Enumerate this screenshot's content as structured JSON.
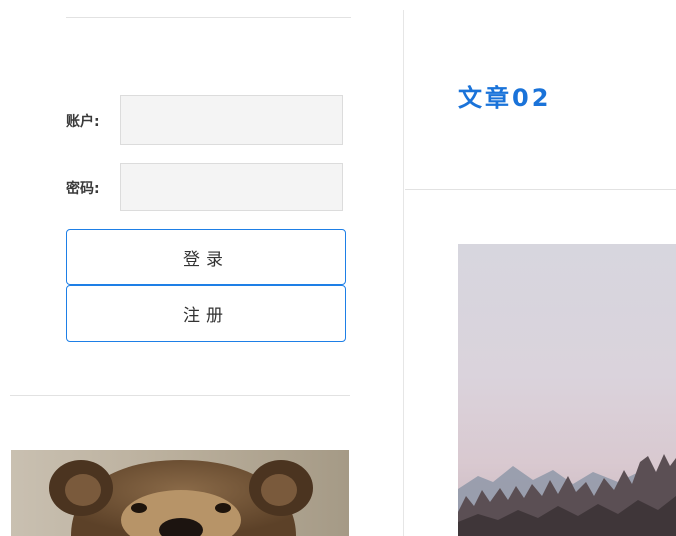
{
  "login": {
    "account_label": "账户:",
    "password_label": "密码:",
    "account_value": "",
    "password_value": "",
    "login_button": "登录",
    "register_button": "注册"
  },
  "article": {
    "title": "文章02"
  },
  "colors": {
    "accent": "#1e7fe6",
    "title": "#1a73d9",
    "input_bg": "#f4f4f4",
    "divider": "#e2e2e2"
  },
  "images": {
    "bear": "bear-photo",
    "mountains": "mountain-landscape-photo"
  }
}
